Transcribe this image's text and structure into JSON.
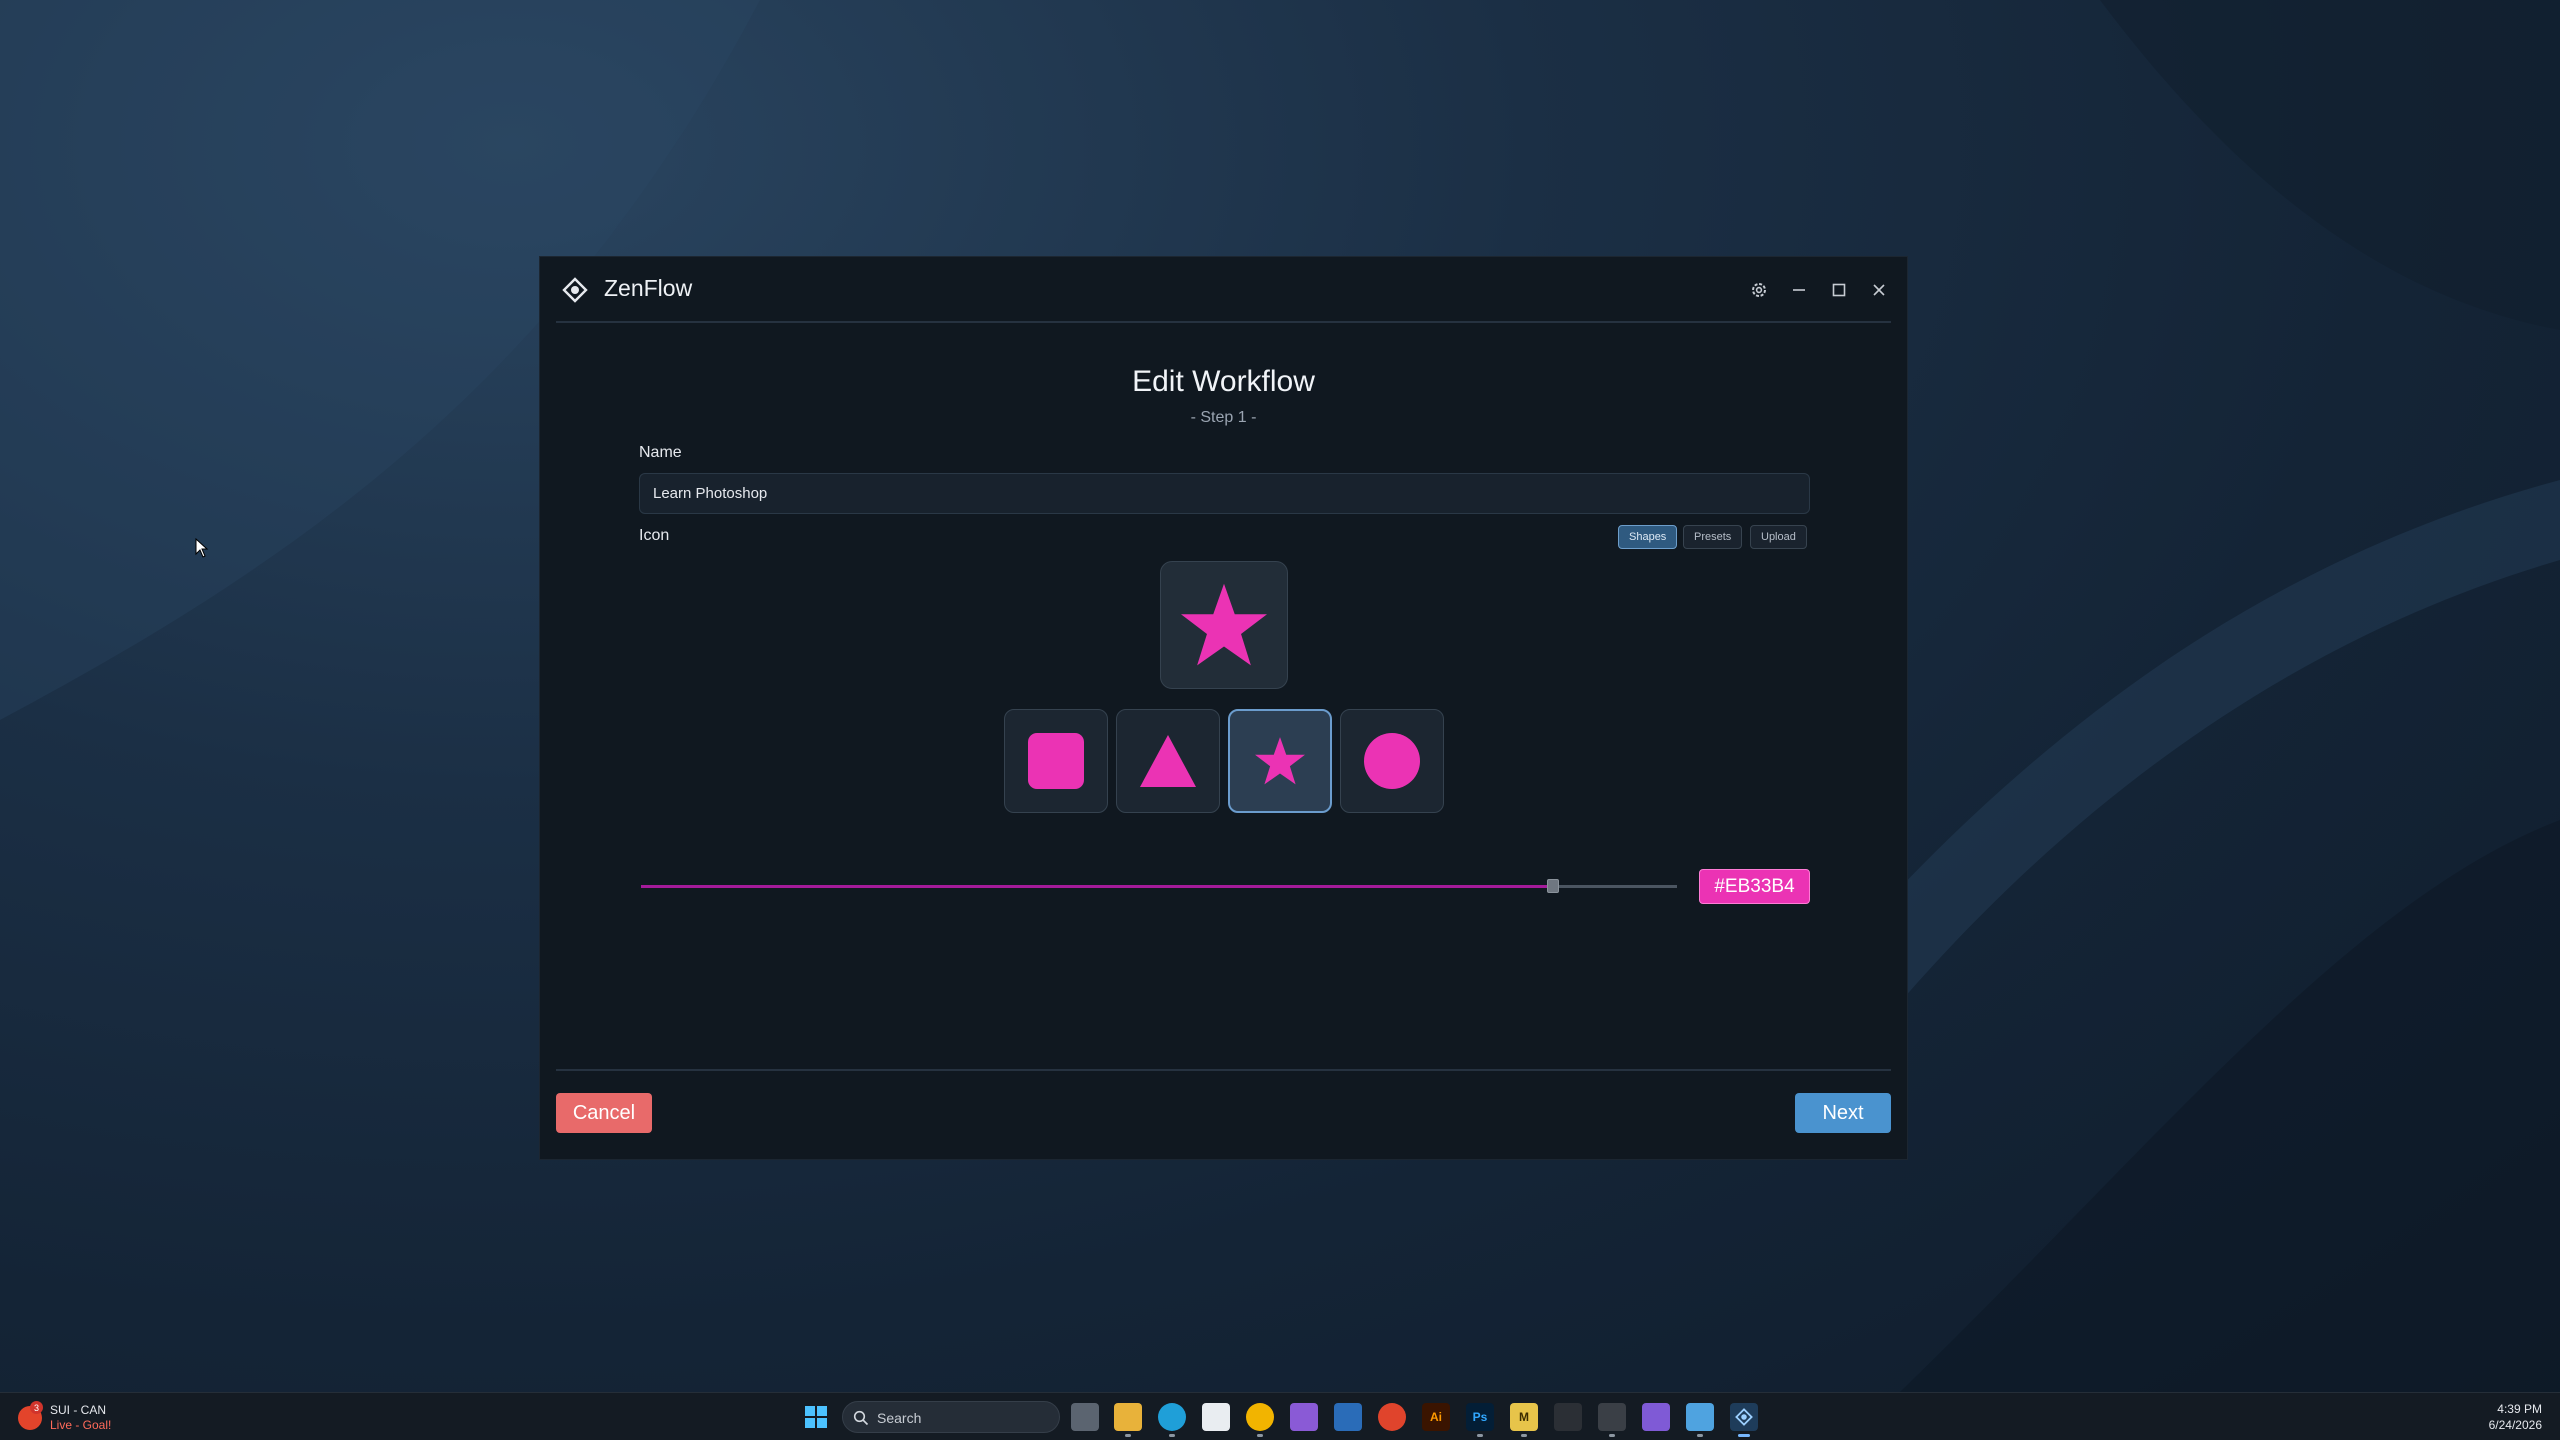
{
  "window": {
    "app_name": "ZenFlow",
    "controls": [
      "settings-icon",
      "minimize-icon",
      "maximize-icon",
      "close-icon"
    ]
  },
  "form": {
    "title": "Edit Workflow",
    "step": "- Step 1 -",
    "name_label": "Name",
    "name_value": "Learn Photoshop",
    "icon_label": "Icon",
    "tabs": [
      {
        "label": "Shapes",
        "active": true
      },
      {
        "label": "Presets",
        "active": false
      },
      {
        "label": "Upload",
        "active": false
      }
    ],
    "preview_shape": "star-icon",
    "shapes": [
      {
        "icon": "square-icon",
        "selected": false
      },
      {
        "icon": "triangle-icon",
        "selected": false
      },
      {
        "icon": "star-icon",
        "selected": true
      },
      {
        "icon": "circle-icon",
        "selected": false
      }
    ],
    "color_slider_fraction": 0.88,
    "color_hex": "#EB33B4",
    "cancel_label": "Cancel",
    "next_label": "Next"
  },
  "colors": {
    "accent": "#EB33B4",
    "primary_button": "#4A93CF",
    "danger_button": "#E86A6A"
  },
  "taskbar": {
    "widget_title": "SUI - CAN",
    "widget_subtitle": "Live - Goal!",
    "widget_badge": "3",
    "search_placeholder": "Search",
    "apps": [
      "task-view-icon",
      "file-explorer-icon",
      "edge-icon",
      "notepad-icon",
      "chrome-icon",
      "visual-studio-icon",
      "powershell-icon",
      "browser-icon",
      "illustrator-icon",
      "photoshop-icon",
      "m-app-icon",
      "terminal-icon",
      "terminal-admin-icon",
      "obsidian-icon",
      "notepad-plus-icon",
      "zenflow-icon"
    ],
    "time": "4:39 PM",
    "date": "6/24/2026"
  }
}
